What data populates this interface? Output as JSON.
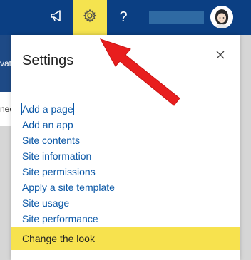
{
  "topbar": {
    "help_glyph": "?",
    "icons": [
      "megaphone-icon",
      "gear-icon",
      "avatar"
    ],
    "colors": {
      "bar": "#0b3f83",
      "settings_highlight": "#f5e34f"
    }
  },
  "underlay": {
    "fragment1": "vat",
    "fragment2": "nec"
  },
  "settings_panel": {
    "title": "Settings",
    "close_glyph": "✕",
    "items": [
      {
        "label": "Add a page"
      },
      {
        "label": "Add an app"
      },
      {
        "label": "Site contents"
      },
      {
        "label": "Site information"
      },
      {
        "label": "Site permissions"
      },
      {
        "label": "Apply a site template"
      },
      {
        "label": "Site usage"
      },
      {
        "label": "Site performance"
      },
      {
        "label": "Change the look"
      }
    ],
    "highlight_color": "#f7e24e",
    "link_color": "#0a57a6"
  },
  "annotation": {
    "arrow_color": "#e81e1e"
  }
}
